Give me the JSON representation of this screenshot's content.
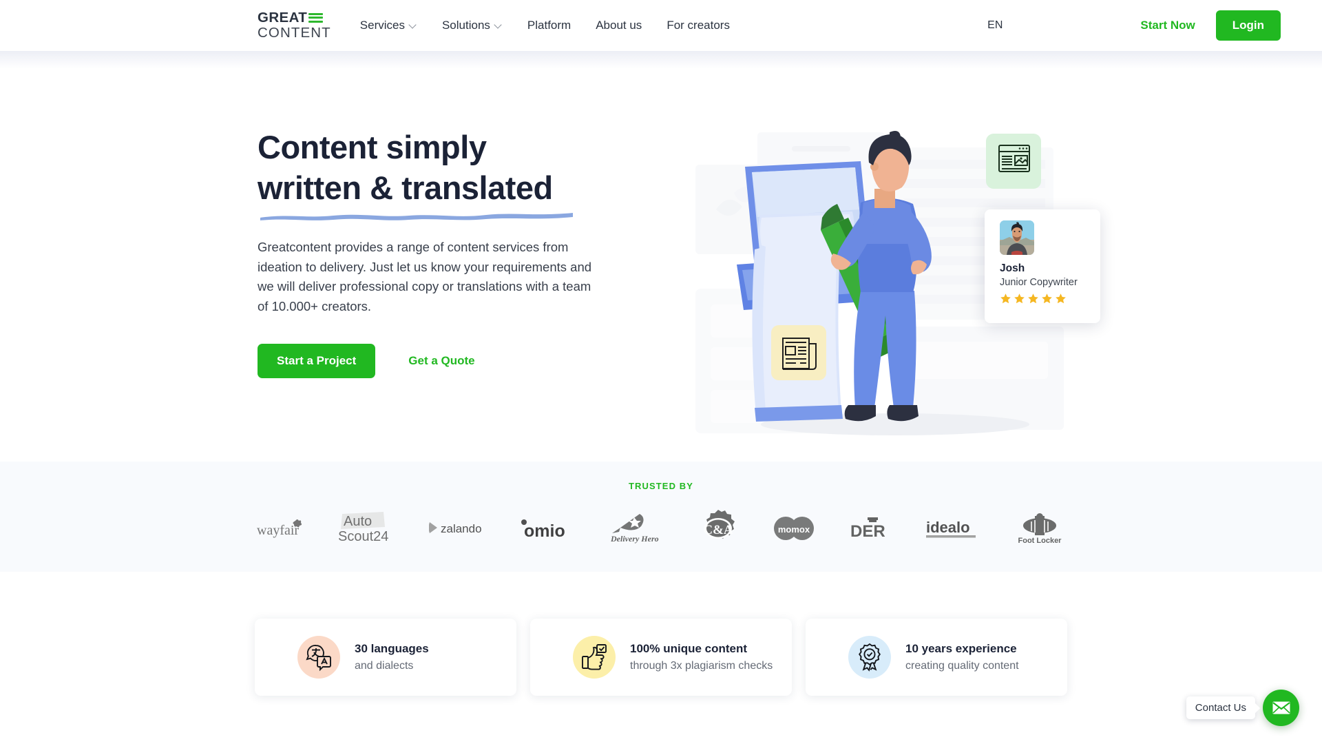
{
  "header": {
    "logo": {
      "line1": "GREAT",
      "line2": "CONTENT",
      "bars_color": "#2eb82e"
    },
    "nav": [
      {
        "label": "Services",
        "has_dropdown": true,
        "icon": "chevron-down-icon"
      },
      {
        "label": "Solutions",
        "has_dropdown": true,
        "icon": "chevron-down-icon"
      },
      {
        "label": "Platform",
        "has_dropdown": false
      },
      {
        "label": "About us",
        "has_dropdown": false
      },
      {
        "label": "For creators",
        "has_dropdown": false
      }
    ],
    "language": "EN",
    "start_now": "Start Now",
    "login": "Login",
    "accent_green": "#21b821"
  },
  "hero": {
    "title_line1": "Content simply",
    "title_line2": "written & translated",
    "underline_color": "#8aa7e0",
    "paragraph": "Greatcontent provides a range of content services from ideation to delivery. Just let us know your requirements and we will deliver professional copy or translations with a team of 10.000+ creators.",
    "primary_cta": "Start a Project",
    "secondary_cta": "Get a Quote",
    "profile_card": {
      "name": "Josh",
      "role": "Junior Copywriter",
      "rating": 5,
      "star_color": "#f5b722"
    },
    "badges": [
      {
        "name": "webpage-badge",
        "color": "#d9f2dc",
        "icon": "webpage-icon"
      },
      {
        "name": "newspaper-badge",
        "color": "#f8eec2",
        "icon": "newspaper-icon"
      }
    ]
  },
  "trusted": {
    "label": "TRUSTED BY",
    "label_color": "#21b821",
    "brands": [
      {
        "name": "wayfair",
        "label": "wayfair"
      },
      {
        "name": "autoscout24",
        "label": "AutoScout24"
      },
      {
        "name": "zalando",
        "label": "zalando"
      },
      {
        "name": "omio",
        "label": "omio"
      },
      {
        "name": "delivery-hero",
        "label": "Delivery Hero"
      },
      {
        "name": "c-and-a",
        "label": "C&A"
      },
      {
        "name": "momox",
        "label": "momox"
      },
      {
        "name": "der",
        "label": "DER"
      },
      {
        "name": "idealo",
        "label": "idealo"
      },
      {
        "name": "foot-locker",
        "label": "Foot Locker"
      }
    ]
  },
  "features": [
    {
      "title": "30 languages",
      "subtitle": "and dialects",
      "icon": "translate-icon",
      "icon_bg": "#fbd9c7"
    },
    {
      "title": "100% unique content",
      "subtitle": "through 3x plagiarism checks",
      "icon": "thumbs-up-check-icon",
      "icon_bg": "#fcefa9"
    },
    {
      "title": "10 years experience",
      "subtitle": "creating quality content",
      "icon": "award-ribbon-icon",
      "icon_bg": "#d8ecfa"
    }
  ],
  "contact": {
    "tooltip": "Contact Us",
    "icon": "envelope-icon",
    "color": "#21b821"
  }
}
